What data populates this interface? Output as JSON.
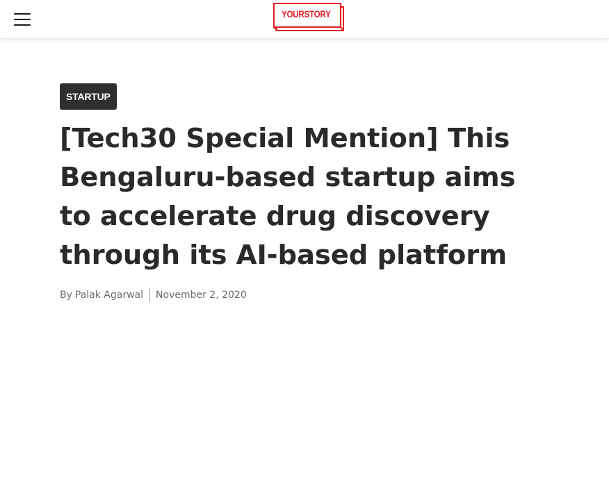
{
  "header": {
    "logo_text": "YOURSTORY",
    "brand_color": "#e31e24"
  },
  "article": {
    "category": "STARTUP",
    "title": "[Tech30 Special Mention] This Bengaluru-based startup aims to accelerate drug discovery through its AI-based platform",
    "byline_prefix": "By",
    "author": "Palak Agarwal",
    "date": "November 2, 2020"
  },
  "icons": {
    "menu": "hamburger-menu-icon"
  }
}
